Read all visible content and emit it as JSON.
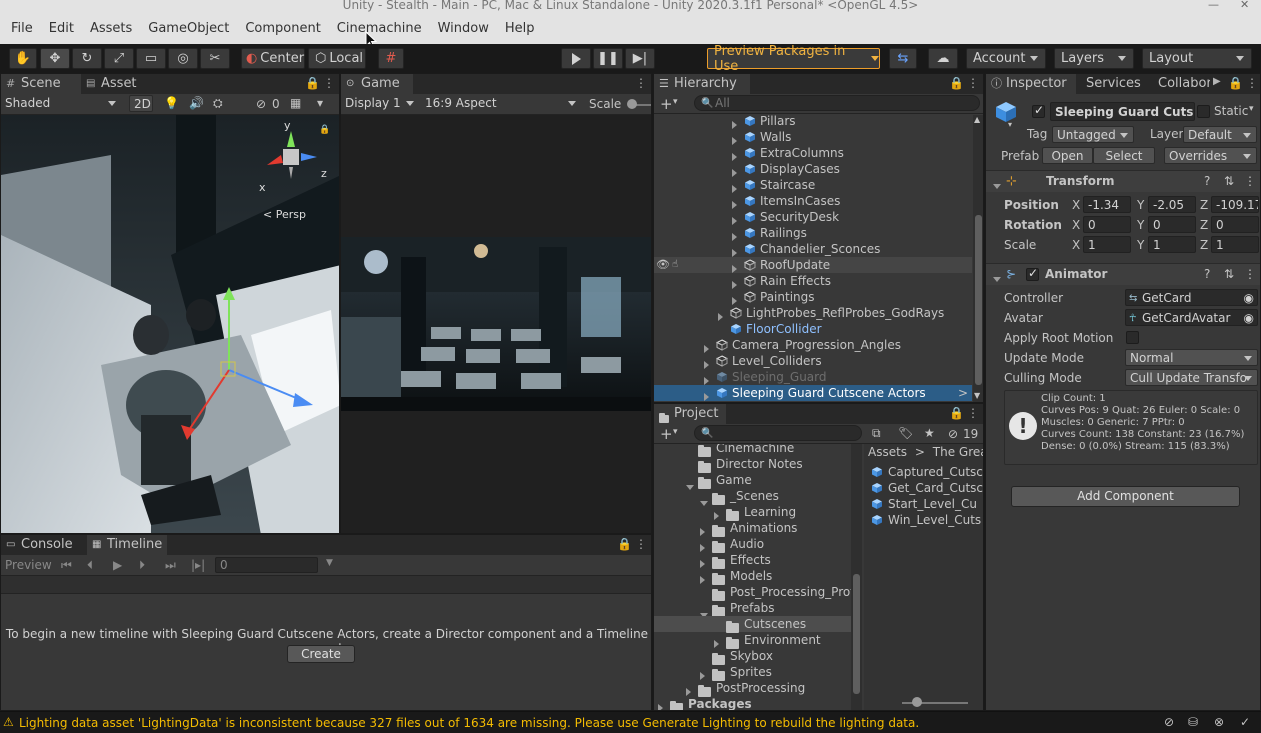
{
  "window": {
    "title": "Unity - Stealth - Main - PC, Mac & Linux Standalone - Unity 2020.3.1f1 Personal* <OpenGL 4.5>"
  },
  "menu": [
    "File",
    "Edit",
    "Assets",
    "GameObject",
    "Component",
    "Cinemachine",
    "Window",
    "Help"
  ],
  "toolbar": {
    "pivot_label": "Center",
    "space_label": "Local",
    "preview_packages": "Preview Packages in Use",
    "account": "Account",
    "layers": "Layers",
    "layout": "Layout"
  },
  "scene": {
    "tabs": [
      "Scene",
      "Asset Store"
    ],
    "shading": "Shaded",
    "mode_2d": "2D",
    "hidden_count": "0",
    "persp_label": "< Persp",
    "gizmo_axes": {
      "x": "x",
      "y": "y",
      "z": "z"
    }
  },
  "game": {
    "tab": "Game",
    "display": "Display 1",
    "aspect": "16:9 Aspect",
    "scale_label": "Scale"
  },
  "hierarchy": {
    "tab": "Hierarchy",
    "search_placeholder": "All",
    "items": [
      {
        "label": "Pillars",
        "state": "normal"
      },
      {
        "label": "Walls",
        "state": "normal"
      },
      {
        "label": "ExtraColumns",
        "state": "normal"
      },
      {
        "label": "DisplayCases",
        "state": "normal"
      },
      {
        "label": "Staircase",
        "state": "normal"
      },
      {
        "label": "ItemsInCases",
        "state": "normal"
      },
      {
        "label": "SecurityDesk",
        "state": "normal"
      },
      {
        "label": "Railings",
        "state": "normal"
      },
      {
        "label": "Chandelier_Sconces",
        "state": "normal"
      },
      {
        "label": "RoofUpdate",
        "state": "hover"
      },
      {
        "label": "Rain Effects",
        "state": "normal"
      },
      {
        "label": "Paintings",
        "state": "normal"
      },
      {
        "label": "LightProbes_ReflProbes_GodRays",
        "state": "normal"
      },
      {
        "label": "FloorCollider",
        "state": "prefab"
      },
      {
        "label": "Camera_Progression_Angles",
        "state": "normal"
      },
      {
        "label": "Level_Colliders",
        "state": "normal"
      },
      {
        "label": "Sleeping_Guard",
        "state": "disabled"
      },
      {
        "label": "Sleeping Guard Cutscene Actors",
        "state": "selected"
      }
    ]
  },
  "inspector": {
    "tabs": [
      "Inspector",
      "Services",
      "Collabora"
    ],
    "object_name": "Sleeping Guard Cutsce",
    "static_label": "Static",
    "tag_label": "Tag",
    "tag_value": "Untagged",
    "layer_label": "Layer",
    "layer_value": "Default",
    "prefab_label": "Prefab",
    "open_btn": "Open",
    "select_btn": "Select",
    "overrides_btn": "Overrides",
    "transform": {
      "title": "Transform",
      "position_label": "Position",
      "rotation_label": "Rotation",
      "scale_label": "Scale",
      "position": {
        "x": "-1.34",
        "y": "-2.05",
        "z": "-109.17"
      },
      "rotation": {
        "x": "0",
        "y": "0",
        "z": "0"
      },
      "scale": {
        "x": "1",
        "y": "1",
        "z": "1"
      }
    },
    "animator": {
      "title": "Animator",
      "controller_label": "Controller",
      "controller_value": "GetCard",
      "avatar_label": "Avatar",
      "avatar_value": "GetCardAvatar",
      "apply_root_motion_label": "Apply Root Motion",
      "update_mode_label": "Update Mode",
      "update_mode_value": "Normal",
      "culling_mode_label": "Culling Mode",
      "culling_mode_value": "Cull Update Transfo",
      "info_lines": [
        "Clip Count: 1",
        "Curves Pos: 9 Quat: 26 Euler: 0 Scale: 0",
        "Muscles: 0 Generic: 7 PPtr: 0",
        "Curves Count: 138 Constant: 23 (16.7%)",
        "Dense: 0 (0.0%) Stream: 115 (83.3%)"
      ]
    },
    "add_component": "Add Component"
  },
  "timeline": {
    "tabs": [
      "Console",
      "Timeline"
    ],
    "preview_label": "Preview",
    "frame_value": "0",
    "message": "To begin a new timeline with Sleeping Guard Cutscene Actors, create a Director component and a Timeline asset",
    "create_btn": "Create"
  },
  "project": {
    "tab": "Project",
    "hidden_count": "19",
    "tree": [
      {
        "label": "Cinemachine",
        "indent": 2,
        "arrow": "none"
      },
      {
        "label": "Director Notes",
        "indent": 2,
        "arrow": "none"
      },
      {
        "label": "Game",
        "indent": 2,
        "arrow": "down"
      },
      {
        "label": "_Scenes",
        "indent": 3,
        "arrow": "down"
      },
      {
        "label": "Learning",
        "indent": 4,
        "arrow": "right"
      },
      {
        "label": "Animations",
        "indent": 3,
        "arrow": "right"
      },
      {
        "label": "Audio",
        "indent": 3,
        "arrow": "right"
      },
      {
        "label": "Effects",
        "indent": 3,
        "arrow": "right"
      },
      {
        "label": "Models",
        "indent": 3,
        "arrow": "right"
      },
      {
        "label": "Post_Processing_Prof",
        "indent": 3,
        "arrow": "none"
      },
      {
        "label": "Prefabs",
        "indent": 3,
        "arrow": "down"
      },
      {
        "label": "Cutscenes",
        "indent": 4,
        "arrow": "none",
        "selected": true
      },
      {
        "label": "Environment",
        "indent": 4,
        "arrow": "right"
      },
      {
        "label": "Skybox",
        "indent": 3,
        "arrow": "none"
      },
      {
        "label": "Sprites",
        "indent": 3,
        "arrow": "right"
      },
      {
        "label": "PostProcessing",
        "indent": 2,
        "arrow": "right"
      },
      {
        "label": "Packages",
        "indent": 0,
        "arrow": "right",
        "bold": true
      }
    ],
    "breadcrumb": [
      "Assets",
      "The Great"
    ],
    "files": [
      "Captured_Cutsc",
      "Get_Card_Cutsc",
      "Start_Level_Cu",
      "Win_Level_Cuts"
    ]
  },
  "status": {
    "message": "Lighting data asset 'LightingData' is inconsistent because 327 files out of 1634 are missing.  Please use Generate Lighting to rebuild the lighting data."
  },
  "colors": {
    "accent_blue": "#4c7eff",
    "selected_row": "#2c5d87",
    "warning_text": "#f4bc02",
    "prefab_blue": "#8fc0ff"
  }
}
